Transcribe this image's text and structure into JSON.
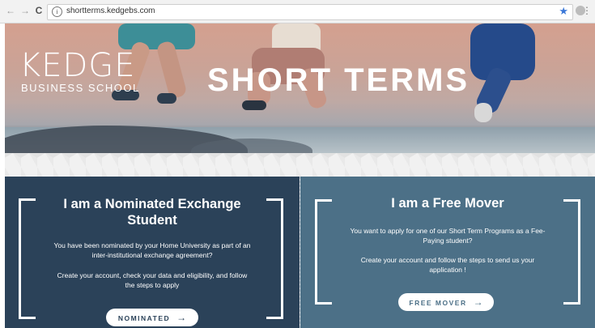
{
  "browser": {
    "url": "shortterms.kedgebs.com",
    "back_glyph": "←",
    "forward_glyph": "→",
    "reload_glyph": "C",
    "info_glyph": "i",
    "star_glyph": "★",
    "menu_glyph": "⋮"
  },
  "hero": {
    "logo_main": "KEDGE",
    "logo_sub": "BUSINESS SCHOOL",
    "title": "SHORT TERMS"
  },
  "cards": {
    "nominated": {
      "title": "I am a Nominated Exchange Student",
      "para1": "You have been nominated by your Home University as part of an inter-institutional exchange agreement?",
      "para2": "Create your account, check your data and eligibility, and follow the steps to apply",
      "button_label": "NOMINATED",
      "arrow_glyph": "→"
    },
    "free_mover": {
      "title": "I am a Free Mover",
      "para1": "You want to apply for one of our Short Term Programs as a Fee-Paying student?",
      "para2": "Create your account and follow the steps to send us your application !",
      "button_label": "FREE MOVER",
      "arrow_glyph": "→"
    }
  },
  "colors": {
    "nominated_bg": "#2b4259",
    "free_mover_bg": "#4c7087",
    "nominated_button_text": "#2b4259",
    "free_mover_button_text": "#4c7087",
    "star": "#3b78d8"
  }
}
